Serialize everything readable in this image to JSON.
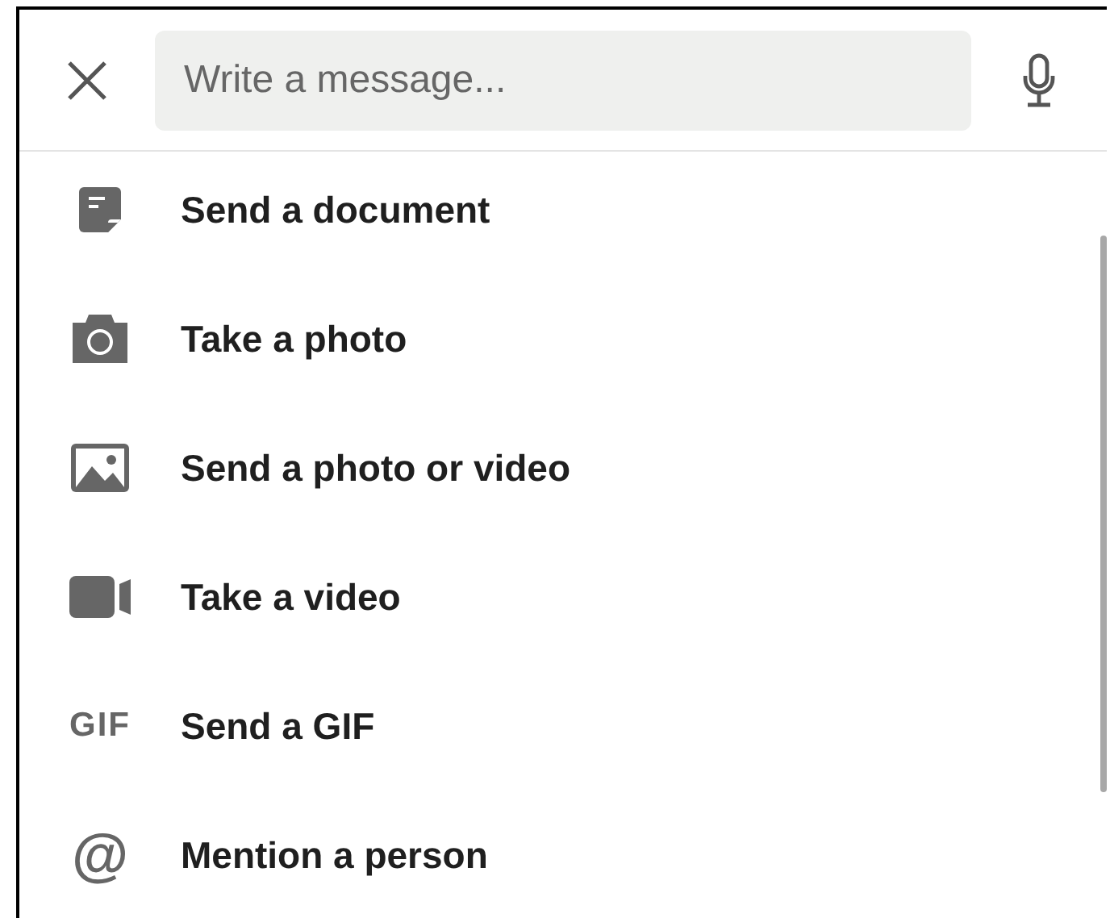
{
  "composer": {
    "placeholder": "Write a message..."
  },
  "actions": [
    {
      "kind": "document",
      "label": "Send a document"
    },
    {
      "kind": "camera",
      "label": "Take a photo"
    },
    {
      "kind": "image",
      "label": "Send a photo or video"
    },
    {
      "kind": "video",
      "label": "Take a video"
    },
    {
      "kind": "gif",
      "icon_text": "GIF",
      "label": "Send a GIF"
    },
    {
      "kind": "mention",
      "icon_text": "@",
      "label": "Mention a person"
    }
  ]
}
